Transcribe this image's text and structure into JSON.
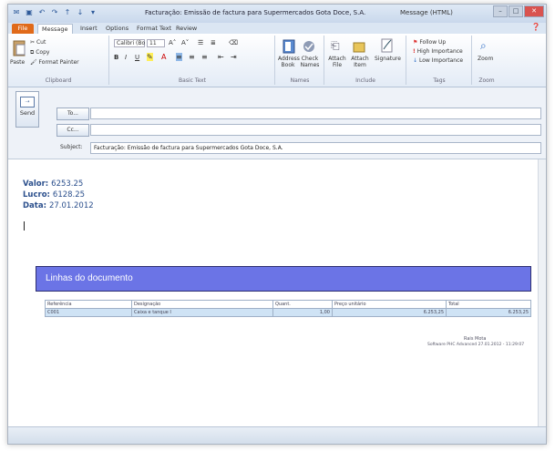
{
  "window": {
    "title": "Facturação: Emissão de factura para Supermercados Gota Doce, S.A.",
    "message_type": "Message (HTML)"
  },
  "tabs": [
    "File",
    "Message",
    "Insert",
    "Options",
    "Format Text",
    "Review"
  ],
  "ribbon": {
    "clipboard": {
      "paste": "Paste",
      "cut": "Cut",
      "copy": "Copy",
      "format_painter": "Format Painter",
      "label": "Clipboard"
    },
    "basic_text": {
      "font": "Calibri (Bo",
      "size": "11",
      "label": "Basic Text"
    },
    "names": {
      "address_book": "Address Book",
      "check_names": "Check Names",
      "label": "Names"
    },
    "include": {
      "attach_file": "Attach File",
      "attach_item": "Attach Item",
      "signature": "Signature",
      "label": "Include"
    },
    "tags": {
      "follow_up": "Follow Up",
      "high": "High Importance",
      "low": "Low Importance",
      "label": "Tags"
    },
    "zoom": {
      "zoom": "Zoom",
      "label": "Zoom"
    }
  },
  "compose": {
    "send": "Send",
    "to": "To...",
    "cc": "Cc...",
    "subject_label": "Subject:",
    "to_value": "",
    "cc_value": "",
    "subject_value": "Facturação: Emissão de factura para Supermercados Gota Doce, S.A."
  },
  "message": {
    "valor_label": "Valor:",
    "valor": "6253.25",
    "lucro_label": "Lucro:",
    "lucro": "6128.25",
    "data_label": "Data:",
    "data": "27.01.2012",
    "banner": "Linhas do documento",
    "table_headers": [
      "Referência",
      "Designação",
      "Quant.",
      "Preço unitário",
      "Total"
    ],
    "table_row": [
      "C001",
      "Caixa e tanque I",
      "1,00",
      "6.253,25",
      "6.253,25"
    ],
    "footer_user": "Rais Mota",
    "footer_soft": "Software PHC Advanced 27.01.2012 - 11:29:07"
  },
  "colors": {
    "banner": "#6b74e6",
    "file_tab": "#e06a1a",
    "label_blue": "#2b4f8c"
  }
}
